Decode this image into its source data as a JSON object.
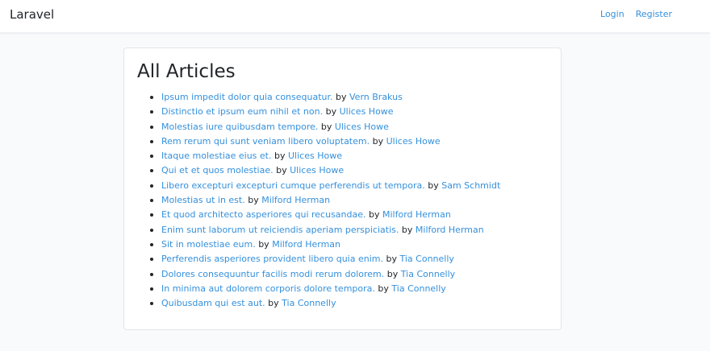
{
  "navbar": {
    "brand": "Laravel",
    "links": [
      {
        "label": "Login"
      },
      {
        "label": "Register"
      }
    ]
  },
  "page": {
    "title": "All Articles",
    "by_word": "by",
    "articles": [
      {
        "title": "Ipsum impedit dolor quia consequatur.",
        "author": "Vern Brakus"
      },
      {
        "title": "Distinctio et ipsum eum nihil et non.",
        "author": "Ulices Howe"
      },
      {
        "title": "Molestias iure quibusdam tempore.",
        "author": "Ulices Howe"
      },
      {
        "title": "Rem rerum qui sunt veniam libero voluptatem.",
        "author": "Ulices Howe"
      },
      {
        "title": "Itaque molestiae eius et.",
        "author": "Ulices Howe"
      },
      {
        "title": "Qui et et quos molestiae.",
        "author": "Ulices Howe"
      },
      {
        "title": "Libero excepturi excepturi cumque perferendis ut tempora.",
        "author": "Sam Schmidt"
      },
      {
        "title": "Molestias ut in est.",
        "author": "Milford Herman"
      },
      {
        "title": "Et quod architecto asperiores qui recusandae.",
        "author": "Milford Herman"
      },
      {
        "title": "Enim sunt laborum ut reiciendis aperiam perspiciatis.",
        "author": "Milford Herman"
      },
      {
        "title": "Sit in molestiae eum.",
        "author": "Milford Herman"
      },
      {
        "title": "Perferendis asperiores provident libero quia enim.",
        "author": "Tia Connelly"
      },
      {
        "title": "Dolores consequuntur facilis modi rerum dolorem.",
        "author": "Tia Connelly"
      },
      {
        "title": "In minima aut dolorem corporis dolore tempora.",
        "author": "Tia Connelly"
      },
      {
        "title": "Quibusdam qui est aut.",
        "author": "Tia Connelly"
      }
    ]
  },
  "colors": {
    "link": "#3490dc",
    "background": "#f8fafc",
    "text": "#212529"
  }
}
